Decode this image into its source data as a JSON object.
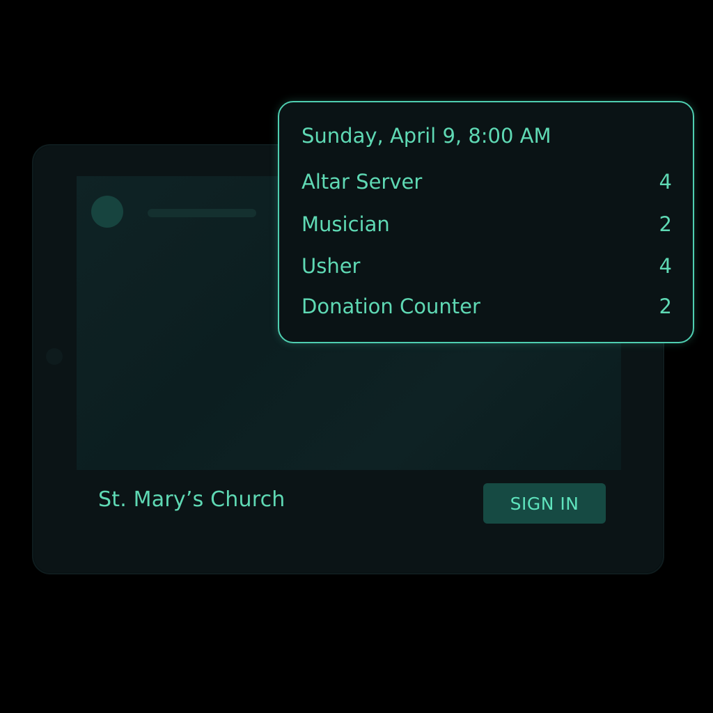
{
  "tablet": {
    "church_name": "St. Mary’s Church",
    "sign_in_label": "SIGN IN"
  },
  "schedule_card": {
    "date_time": "Sunday, April 9, 8:00 AM",
    "roles": [
      {
        "name": "Altar Server",
        "count": "4"
      },
      {
        "name": "Musician",
        "count": "2"
      },
      {
        "name": "Usher",
        "count": "4"
      },
      {
        "name": "Donation Counter",
        "count": "2"
      }
    ]
  },
  "colors": {
    "accent": "#5fd9b4",
    "card_border": "#4fcfb1",
    "button_bg": "#164a43",
    "background": "#000000"
  }
}
